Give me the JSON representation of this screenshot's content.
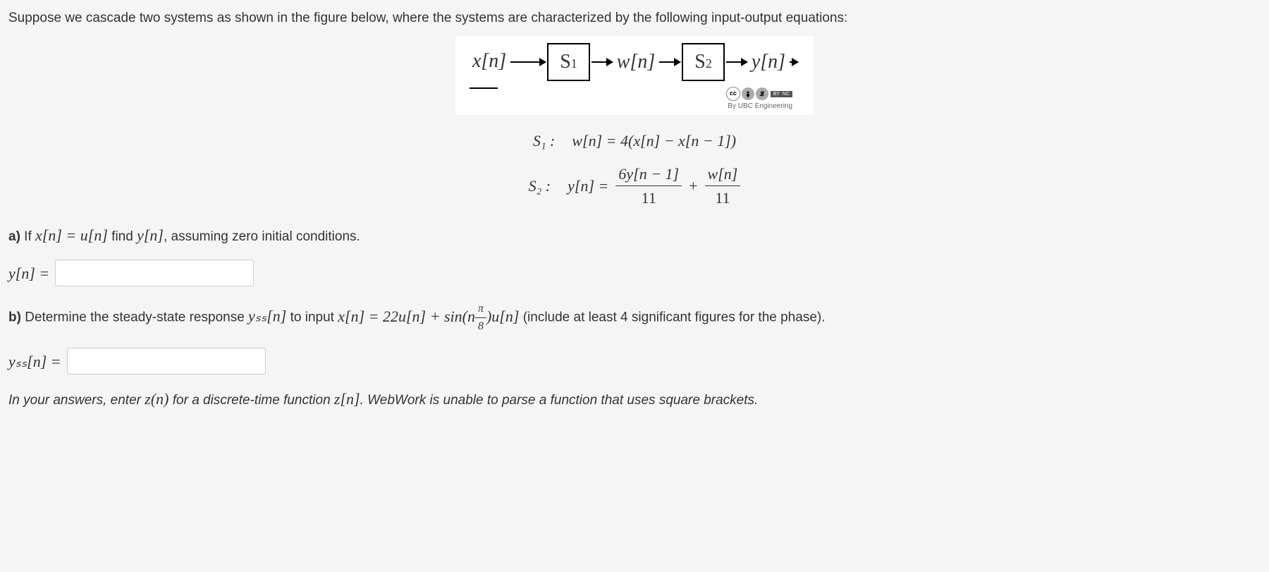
{
  "intro": "Suppose we cascade two systems as shown in the figure below, where the systems are characterized by the following input-output equations:",
  "diagram": {
    "x": "x[n]",
    "s1": "S",
    "s1_sub": "1",
    "w": "w[n]",
    "s2": "S",
    "s2_sub": "2",
    "y": "y[n]",
    "cc_by": "BY",
    "cc_nc": "NC",
    "cc_text": "By UBC Engineering",
    "cc_label": "cc"
  },
  "eq": {
    "s1_label": "S₁ :",
    "s1_body": "w[n] = 4(x[n] − x[n − 1])",
    "s2_label": "S₂ :",
    "s2_lhs": "y[n] =",
    "s2_frac1_num": "6y[n − 1]",
    "s2_frac1_den": "11",
    "s2_plus": "+",
    "s2_frac2_num": "w[n]",
    "s2_frac2_den": "11"
  },
  "partA": {
    "label": "a)",
    "text_before": " If ",
    "cond": "x[n] = u[n]",
    "text_mid": " find ",
    "target": "y[n]",
    "text_after": ", assuming zero initial conditions.",
    "answer_label": "y[n] =",
    "input_value": ""
  },
  "partB": {
    "label": "b)",
    "text_before": " Determine the steady-state response ",
    "yss": "yₛₛ[n]",
    "text_mid1": " to input ",
    "input_expr_lhs": "x[n] = ",
    "input_expr_rhs1": "22u[n] + sin(n",
    "pi_num": "π",
    "pi_den": "8",
    "input_expr_rhs2": ")u[n]",
    "text_after": " (include at least 4 significant figures for the phase).",
    "answer_label": "yₛₛ[n] =",
    "input_value": ""
  },
  "note": {
    "pre": "In your answers, enter ",
    "zn": "z(n)",
    "mid": " for a discrete-time function ",
    "zbr": "z[n]",
    "post": ". WebWork is unable to parse a function that uses square brackets."
  }
}
